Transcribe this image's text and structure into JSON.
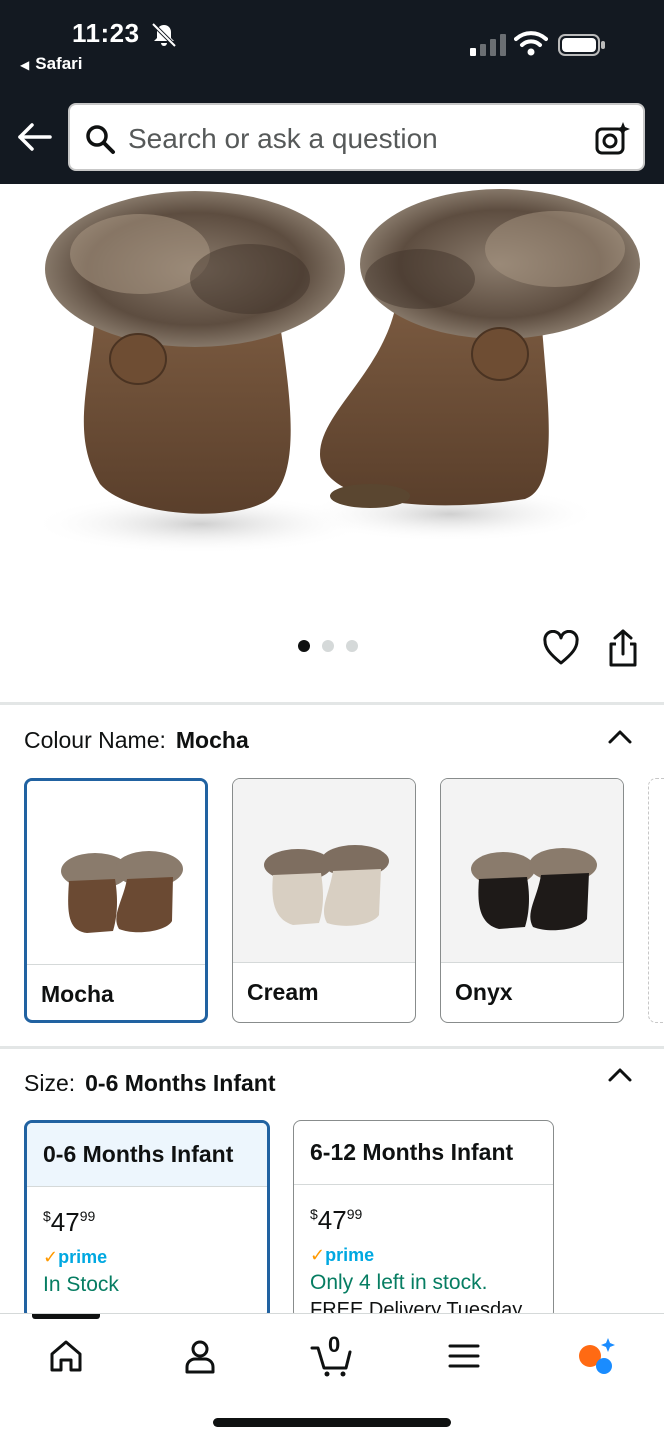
{
  "status_bar": {
    "time": "11:23",
    "back_app": "Safari"
  },
  "header": {
    "search_placeholder": "Search or ask a question"
  },
  "gallery": {
    "dot_count": 3,
    "active_index": 0
  },
  "colour": {
    "label": "Colour Name:",
    "selected": "Mocha",
    "options": [
      {
        "name": "Mocha",
        "boot_color": "#6b4a33",
        "selected": true
      },
      {
        "name": "Cream",
        "boot_color": "#d8cfc2",
        "selected": false
      },
      {
        "name": "Onyx",
        "boot_color": "#1e1a18",
        "selected": false
      }
    ]
  },
  "size": {
    "label": "Size:",
    "selected": "0-6 Months Infant",
    "options": [
      {
        "name": "0-6 Months Infant",
        "price_symbol": "$",
        "price_whole": "47",
        "price_fraction": "99",
        "prime": "prime",
        "stock": "In Stock",
        "delivery": ""
      },
      {
        "name": "6-12 Months Infant",
        "price_symbol": "$",
        "price_whole": "47",
        "price_fraction": "99",
        "prime": "prime",
        "stock": "Only 4 left in stock.",
        "delivery": "FREE Delivery Tuesday"
      }
    ]
  },
  "bottom_nav": {
    "cart_count": "0"
  },
  "colors": {
    "header_bg": "#131921",
    "selected_border": "#2162a1",
    "in_stock_green": "#067d62",
    "prime_blue": "#00a8e1"
  }
}
